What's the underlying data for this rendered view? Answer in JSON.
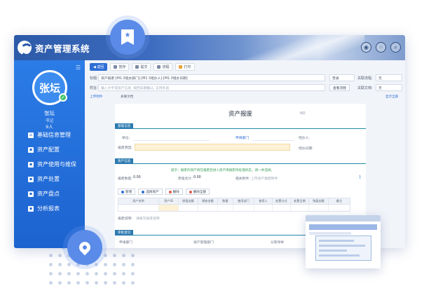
{
  "app": {
    "title": "资产管理系统"
  },
  "user": {
    "avatar_text": "张坛",
    "name": "张坛",
    "role": "书记",
    "count": "9人"
  },
  "nav": [
    "基础信息管理",
    "资产配置",
    "资产使用与维保",
    "资产处置",
    "资产盘点",
    "分析报表"
  ],
  "toolbar": {
    "back": "◀ 返回",
    "b1": "暂存",
    "b2": "提交",
    "b3": "流程",
    "b4": "打印"
  },
  "form_head": {
    "title_label": "标题:",
    "title_value": "资产报废-[M1.3组办部门]-[M1.3组办人]-[M1.3组办日期]",
    "priority_label": "普通",
    "urgency_label": "关联流程:",
    "urgency_value": "无",
    "remark_label": "附言:",
    "remark_ph": "输入文字或资产信息, 按回车键确认, 支持多选",
    "flow_btn": "查看流程",
    "related_label": "关联文档:",
    "related_value": "无",
    "attach": "上传附件",
    "favorite": "关联文档",
    "links": "显示全部"
  },
  "doc": {
    "title": "资产报废",
    "number": "NO",
    "sec1": "基础信息",
    "unit_label": "单位:",
    "dept_label": "申请部门",
    "person_label": "经办人:",
    "date_label": "经办日期:",
    "reason_label": "报废原因:",
    "sec2": "资产信息",
    "notice": "提示：报废的资产将在报废后进入资产库报废待处理状态，请一并选择。",
    "qty_label": "报废数量:",
    "qty_value": "0.00",
    "amount_label": "原值合计:",
    "amount_value": "0.00",
    "attach_label": "相关附件:",
    "attach_ph": "上传资产报废附件",
    "btn_add": "新增",
    "btn_select": "选择资产",
    "btn_delete": "删除",
    "btn_clear": "删除全部",
    "cols": [
      "资产名称",
      "资产ID",
      "原值金额",
      "报废金额",
      "数量",
      "使用部门",
      "使用人",
      "处置方式",
      "处置日期",
      "残值金额",
      "备注"
    ],
    "remark_label": "报废说明:",
    "remark_ph": "请填写报废说明",
    "sec3": "审批意见",
    "approve1": "申请部门",
    "approve2": "资产管理部门",
    "approve3": "分管领导"
  }
}
